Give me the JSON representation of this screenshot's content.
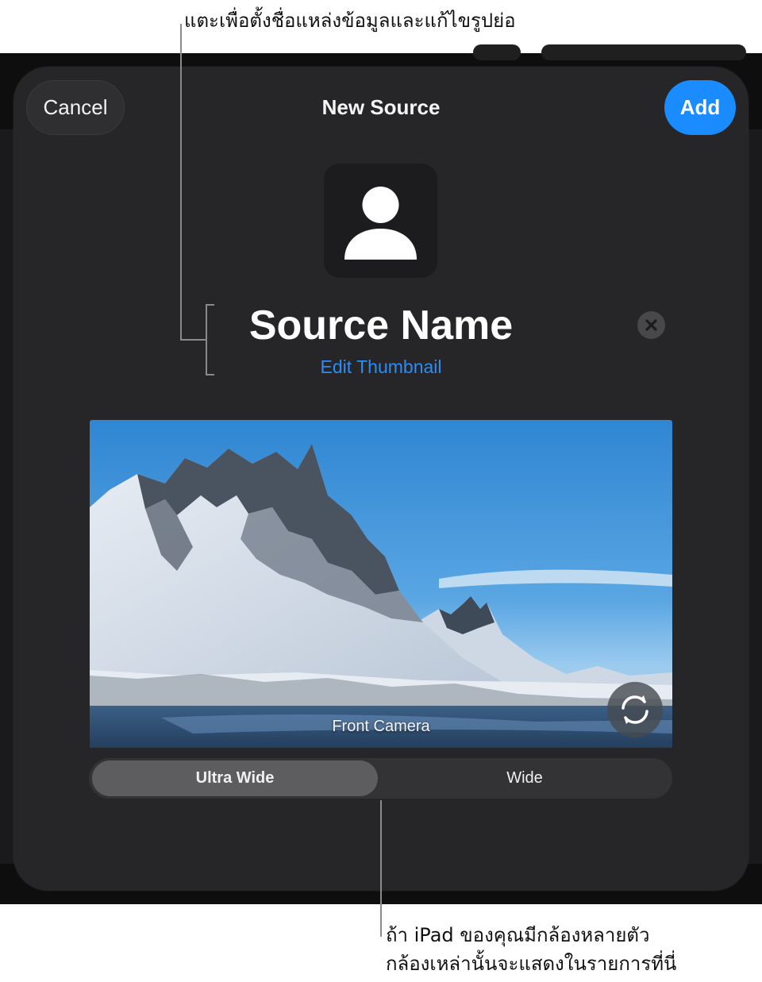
{
  "callouts": {
    "top": "แตะเพื่อตั้งชื่อแหล่งข้อมูลและแก้ไขรูปย่อ",
    "bottom_line1": "ถ้า iPad ของคุณมีกล้องหลายตัว",
    "bottom_line2": "กล้องเหล่านั้นจะแสดงในรายการที่นี่"
  },
  "header": {
    "cancel_label": "Cancel",
    "title": "New Source",
    "add_label": "Add"
  },
  "source": {
    "name": "Source Name",
    "edit_thumbnail_label": "Edit Thumbnail",
    "thumbnail_icon": "person-icon"
  },
  "preview": {
    "camera_label": "Front Camera",
    "flip_icon": "camera-flip-icon"
  },
  "lens_selector": {
    "options": [
      "Ultra Wide",
      "Wide"
    ],
    "selected": "Ultra Wide"
  },
  "colors": {
    "accent": "#1a8cff",
    "modal_background": "#262628",
    "link": "#2a8cf5"
  }
}
